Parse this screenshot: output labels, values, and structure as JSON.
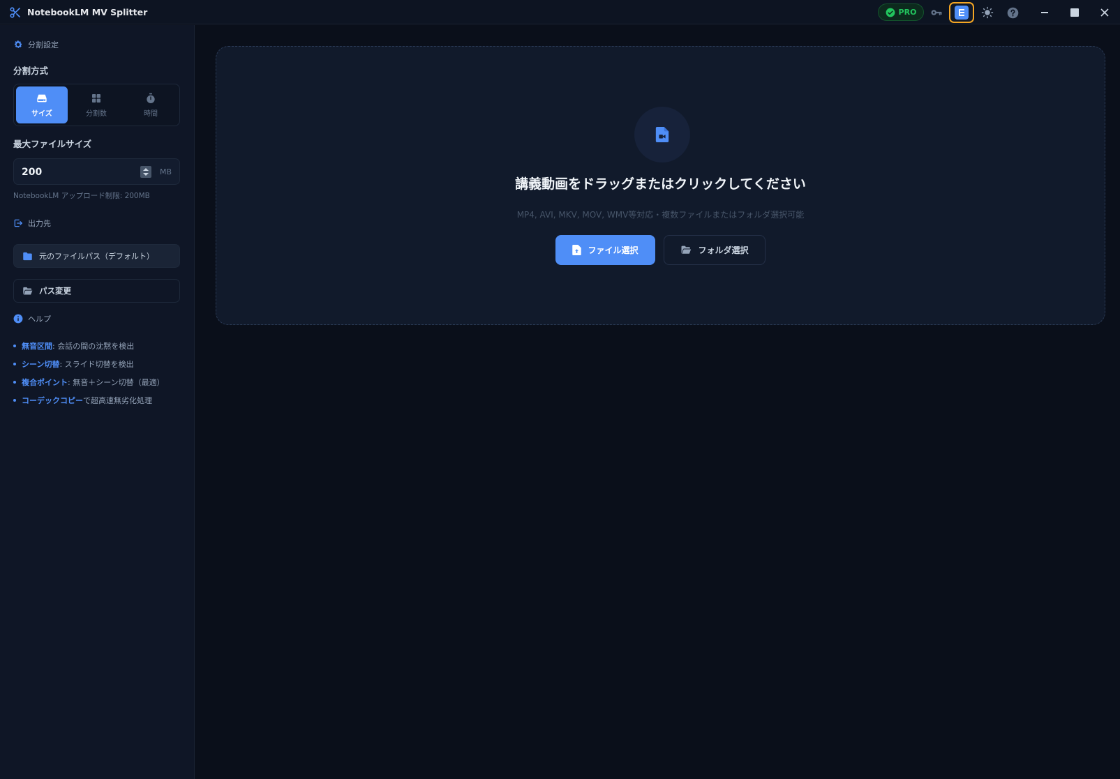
{
  "app": {
    "title": "NotebookLM MV Splitter",
    "pro_label": "PRO"
  },
  "colors": {
    "accent": "#4f8ef7",
    "pro_green": "#22c55e",
    "highlight": "#f5a623"
  },
  "sidebar": {
    "split_settings_heading": "分割設定",
    "split_method_label": "分割方式",
    "modes": [
      {
        "label": "サイズ",
        "icon": "hdd-icon",
        "active": true
      },
      {
        "label": "分割数",
        "icon": "grid-icon",
        "active": false
      },
      {
        "label": "時間",
        "icon": "stopwatch-icon",
        "active": false
      }
    ],
    "max_size_label": "最大ファイルサイズ",
    "max_size_value": "200",
    "max_size_unit": "MB",
    "upload_hint": "NotebookLM アップロード制限: 200MB",
    "output_heading": "出力先",
    "default_path": "元のファイルパス（デフォルト）",
    "change_path": "パス変更",
    "help_heading": "ヘルプ",
    "help_items": [
      {
        "keyword": "無音区間",
        "text": ": 会話の間の沈黙を検出"
      },
      {
        "keyword": "シーン切替",
        "text": ": スライド切替を検出"
      },
      {
        "keyword": "複合ポイント",
        "text": ": 無音＋シーン切替（最適）"
      },
      {
        "keyword": "コーデックコピー",
        "text": " で超高速無劣化処理"
      }
    ]
  },
  "dropzone": {
    "title": "講義動画をドラッグまたはクリックしてください",
    "subtitle": "MP4, AVI, MKV, MOV, WMV等対応・複数ファイルまたはフォルダ選択可能",
    "file_button": "ファイル選択",
    "folder_button": "フォルダ選択"
  }
}
